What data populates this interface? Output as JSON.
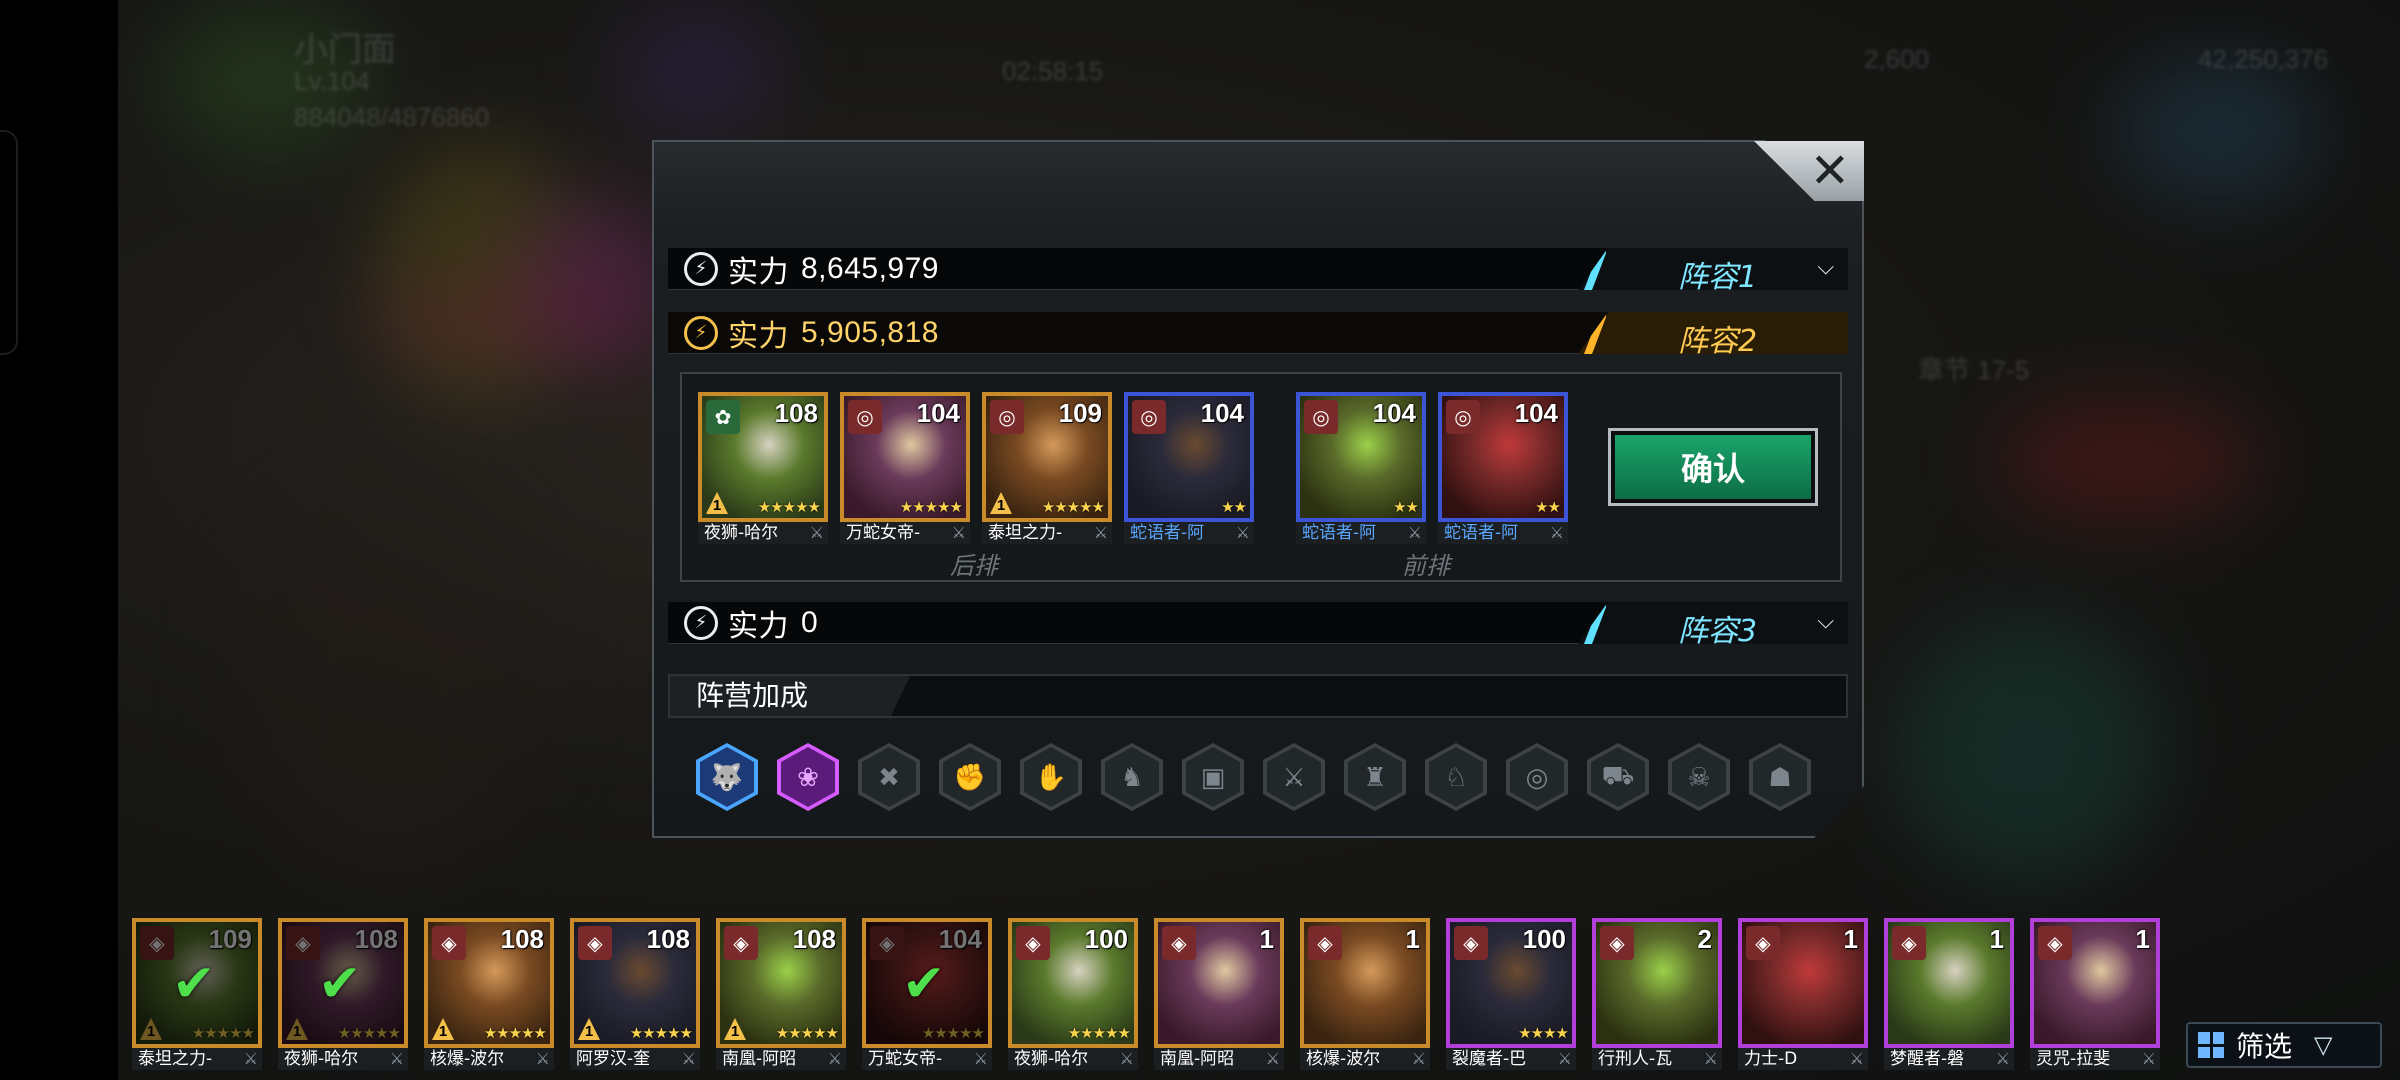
{
  "hud": {
    "player_name": "小门面",
    "player_level": "Lv.104",
    "exp": "884048/4876860",
    "timer": "02:58:15",
    "gems": "2,600",
    "gold": "42,250,376",
    "side_text": "章节 17-5"
  },
  "modal": {
    "close_label": "✕",
    "lineups": [
      {
        "power_label": "实力",
        "power": "8,645,979",
        "tab": "阵容1",
        "color": "#5fe1ff"
      },
      {
        "power_label": "实力",
        "power": "5,905,818",
        "tab": "阵容2",
        "color": "#ffb42a"
      },
      {
        "power_label": "实力",
        "power": "0",
        "tab": "阵容3",
        "color": "#5fe1ff"
      }
    ],
    "confirm_label": "确认",
    "back_row_label": "后排",
    "front_row_label": "前排",
    "selected_heroes": [
      {
        "name": "夜狮-哈尔",
        "level": "108",
        "rarity": "gold",
        "stars": "★★★★★",
        "badge": "1",
        "faction_icon": "leaf-icon"
      },
      {
        "name": "万蛇女帝-",
        "level": "104",
        "rarity": "gold",
        "stars": "★★★★★",
        "badge": "",
        "faction_icon": "target-icon"
      },
      {
        "name": "泰坦之力-",
        "level": "109",
        "rarity": "gold",
        "stars": "★★★★★",
        "badge": "1",
        "faction_icon": "target-icon"
      },
      {
        "name": "蛇语者-阿",
        "level": "104",
        "rarity": "blue",
        "stars": "★★",
        "badge": "",
        "faction_icon": "target-icon"
      },
      {
        "name": "蛇语者-阿",
        "level": "104",
        "rarity": "blue",
        "stars": "★★",
        "badge": "",
        "faction_icon": "target-icon"
      },
      {
        "name": "蛇语者-阿",
        "level": "104",
        "rarity": "blue",
        "stars": "★★",
        "badge": "",
        "faction_icon": "target-icon"
      }
    ],
    "faction_bonus_label": "阵营加成",
    "faction_bonus_icons": [
      "wolf-icon",
      "lotus-icon",
      "crossed-tools-icon",
      "fist-icon",
      "hand-icon",
      "dragon-icon",
      "chest-icon",
      "blades-icon",
      "robot-icon",
      "beast-icon",
      "spiral-icon",
      "truck-icon",
      "skull-icon",
      "ghost-icon"
    ]
  },
  "roster": [
    {
      "name": "泰坦之力-",
      "level": "109",
      "rarity": "gold",
      "stars": "★★★★★",
      "badge": "1",
      "used": true
    },
    {
      "name": "夜狮-哈尔",
      "level": "108",
      "rarity": "gold",
      "stars": "★★★★★",
      "badge": "1",
      "used": true
    },
    {
      "name": "核爆-波尔",
      "level": "108",
      "rarity": "gold",
      "stars": "★★★★★",
      "badge": "1",
      "used": false
    },
    {
      "name": "阿罗汉-奎",
      "level": "108",
      "rarity": "gold",
      "stars": "★★★★★",
      "badge": "1",
      "used": false
    },
    {
      "name": "南凰-阿昭",
      "level": "108",
      "rarity": "gold",
      "stars": "★★★★★",
      "badge": "1",
      "used": false
    },
    {
      "name": "万蛇女帝-",
      "level": "104",
      "rarity": "gold",
      "stars": "★★★★★",
      "badge": "",
      "used": true
    },
    {
      "name": "夜狮-哈尔",
      "level": "100",
      "rarity": "gold",
      "stars": "★★★★★",
      "badge": "",
      "used": false
    },
    {
      "name": "南凰-阿昭",
      "level": "1",
      "rarity": "gold",
      "stars": "",
      "badge": "",
      "used": false
    },
    {
      "name": "核爆-波尔",
      "level": "1",
      "rarity": "gold",
      "stars": "",
      "badge": "",
      "used": false
    },
    {
      "name": "裂魔者-巴",
      "level": "100",
      "rarity": "purple",
      "stars": "★★★★",
      "badge": "",
      "used": false
    },
    {
      "name": "行刑人-瓦",
      "level": "2",
      "rarity": "purple",
      "stars": "",
      "badge": "",
      "used": false
    },
    {
      "name": "力士-D",
      "level": "1",
      "rarity": "purple",
      "stars": "",
      "badge": "",
      "used": false
    },
    {
      "name": "梦醒者-磐",
      "level": "1",
      "rarity": "purple",
      "stars": "",
      "badge": "",
      "used": false
    },
    {
      "name": "灵咒-拉斐",
      "level": "1",
      "rarity": "purple",
      "stars": "",
      "badge": "",
      "used": false
    }
  ],
  "filter_label": "筛选",
  "colors": {
    "gold": "#c98a2a",
    "blue": "#3c55d6",
    "purple": "#b13fd9",
    "confirm_green": "#1aa46a"
  }
}
